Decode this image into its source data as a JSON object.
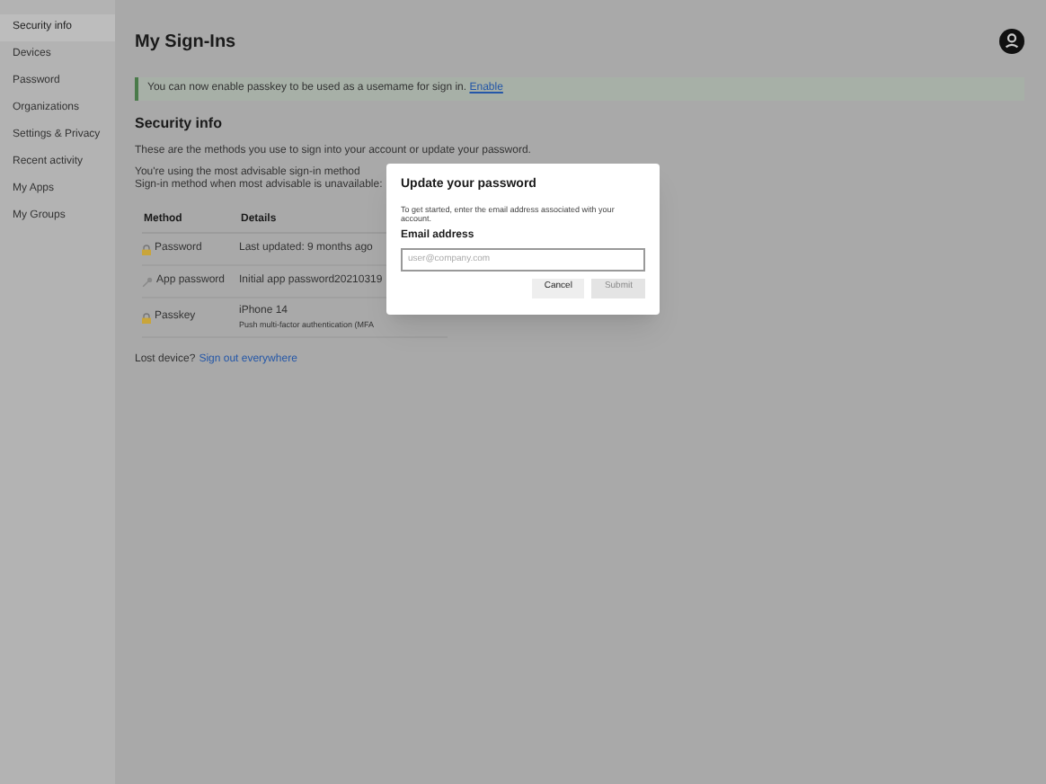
{
  "sidebar": {
    "items": [
      {
        "label": "Security info",
        "selected": true
      },
      {
        "label": "Devices",
        "selected": false
      },
      {
        "label": "Password",
        "selected": false
      },
      {
        "label": "Organizations",
        "selected": false
      },
      {
        "label": "Settings & Privacy",
        "selected": false
      },
      {
        "label": "Recent activity",
        "selected": false
      },
      {
        "label": "My Apps",
        "selected": false
      },
      {
        "label": "My Groups",
        "selected": false
      }
    ]
  },
  "page_title": "My Sign-Ins",
  "banner": {
    "text": "You can now enable passkey to be used as a usemame for sign in.",
    "link": "Enable"
  },
  "section_title": "Security info",
  "intro": "These are the methods you use to sign into your account or update your password.",
  "advice_lines": [
    "You're using the most advisable sign-in method",
    "Sign-in method when most advisable is unavailable:"
  ],
  "table": {
    "columns": [
      "Method",
      "Details"
    ],
    "rows": [
      {
        "kind": "lock",
        "method": "Password",
        "details": [
          "Last updated: 9 months ago"
        ]
      },
      {
        "kind": "key",
        "method": "App password",
        "details": [
          "Initial app password20210319"
        ]
      },
      {
        "kind": "lock",
        "method": "Passkey",
        "details": [
          "iPhone 14",
          "Push multi-factor authentication (MFA"
        ]
      }
    ]
  },
  "lost_device": {
    "text": "Lost device?",
    "link": "Sign out everywhere"
  },
  "dialog": {
    "title": "Update your password",
    "description": "To get started, enter the email address associated with your account.",
    "field_label": "Email address",
    "placeholder": "user@company.com",
    "buttons": [
      {
        "label": "Cancel",
        "disabled": false
      },
      {
        "label": "Submit",
        "disabled": true
      }
    ]
  }
}
